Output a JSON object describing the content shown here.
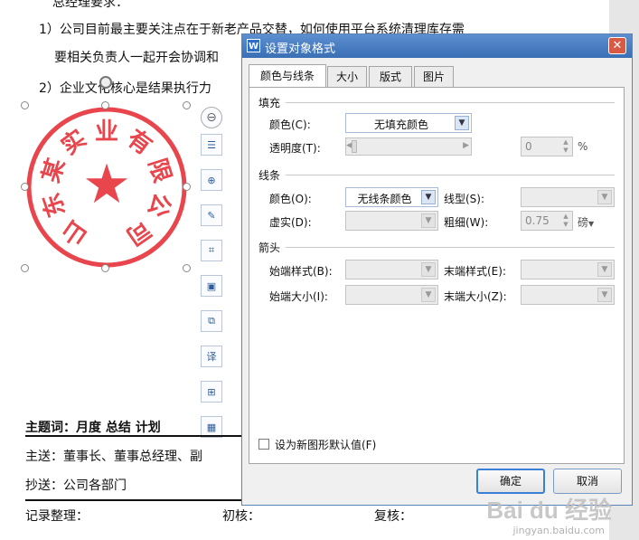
{
  "document": {
    "lines": [
      {
        "id": "line0",
        "text": "总经理要求："
      },
      {
        "id": "line1",
        "text": "1）公司目前最主要关注点在于新老产品交替，如何使用平台系统清理库存需"
      },
      {
        "id": "line2",
        "text": "要相关负责人一起开会协调和"
      },
      {
        "id": "line3",
        "text": "2）企业文化核心是结果执行力"
      },
      {
        "id": "keywords",
        "text": "主题词：月度    总结    计划"
      },
      {
        "id": "to",
        "text": "主送：董事长、董事总经理、副"
      },
      {
        "id": "cc",
        "text": "抄送：公司各部门"
      }
    ],
    "footer": {
      "recorder": "记录整理：",
      "first_check": "初核：",
      "recheck": "复核："
    }
  },
  "seal": {
    "text": "山东某实业有限公司",
    "chars": [
      "山",
      "东",
      "某",
      "实",
      "业",
      "有",
      "限",
      "公",
      "司"
    ],
    "star": "★",
    "color": "#e8454c"
  },
  "side_toolbar": {
    "buttons": [
      {
        "name": "collapse-icon",
        "glyph": "⊖"
      },
      {
        "name": "wrap-layout-icon",
        "glyph": "☰"
      },
      {
        "name": "zoom-in-icon",
        "glyph": "⊕"
      },
      {
        "name": "pen-edit-icon",
        "glyph": "✎"
      },
      {
        "name": "crop-icon",
        "glyph": "⌗"
      },
      {
        "name": "picture-frame-icon",
        "glyph": "▣"
      },
      {
        "name": "replace-image-icon",
        "glyph": "⧉"
      },
      {
        "name": "translate-image-icon",
        "glyph": "译"
      },
      {
        "name": "add-image-icon",
        "glyph": "⊞"
      },
      {
        "name": "image-more-icon",
        "glyph": "▦"
      }
    ]
  },
  "dialog": {
    "app_icon": "W",
    "title": "设置对象格式",
    "close": "✕",
    "tabs": [
      "颜色与线条",
      "大小",
      "版式",
      "图片"
    ],
    "fill": {
      "section": "填充",
      "color_label": "颜色(C):",
      "color_value": "无填充颜色",
      "transparency_label": "透明度(T):",
      "transparency_value": "0",
      "transparency_unit": "%"
    },
    "line": {
      "section": "线条",
      "color_label": "颜色(O):",
      "color_value": "无线条颜色",
      "type_label": "线型(S):",
      "dash_label": "虚实(D):",
      "weight_label": "粗细(W):",
      "weight_value": "0.75",
      "weight_unit": "磅"
    },
    "arrow": {
      "section": "箭头",
      "begin_style_label": "始端样式(B):",
      "end_style_label": "末端样式(E):",
      "begin_size_label": "始端大小(I):",
      "end_size_label": "末端大小(Z):"
    },
    "default_checkbox_label": "设为新图形默认值(F)",
    "ok": "确定",
    "cancel": "取消"
  },
  "watermark": {
    "brand": "Bai du 经验",
    "url": "jingyan.baidu.com"
  }
}
